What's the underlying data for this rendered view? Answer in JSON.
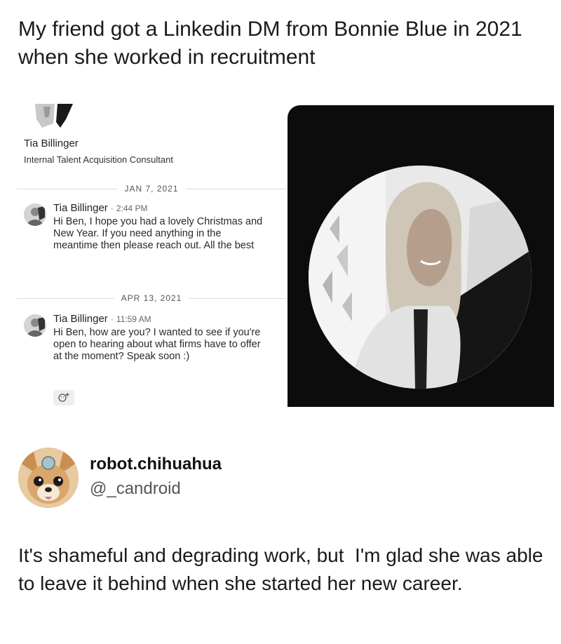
{
  "post": {
    "headline": "My friend got a Linkedin DM from Bonnie Blue in 2021 when she worked in recruitment"
  },
  "linkedin": {
    "profile_name": "Tia Billinger",
    "profile_title": "Internal Talent Acquisition Consultant",
    "messages": [
      {
        "date": "JAN 7, 2021",
        "sender": "Tia Billinger",
        "separator": "·",
        "time": "2:44 PM",
        "body": "Hi Ben, I hope you had a lovely Christmas and New Year. If you need anything in the meantime then please reach out. All the best"
      },
      {
        "date": "APR 13, 2021",
        "sender": "Tia Billinger",
        "separator": "·",
        "time": "11:59 AM",
        "body": "Hi Ben, how are you? I wanted to see if you're open to hearing about what firms have to offer at the moment? Speak soon :)"
      }
    ],
    "reaction_icon": "add-reaction-icon"
  },
  "tweet": {
    "display_name": "robot.chihuahua",
    "handle": "@_candroid",
    "text": "It's shameful and degrading work, but  I'm glad she was able to leave it behind when she started her new career."
  },
  "colors": {
    "photo_background": "#0c0c0c",
    "divider": "#dcdcdc"
  }
}
